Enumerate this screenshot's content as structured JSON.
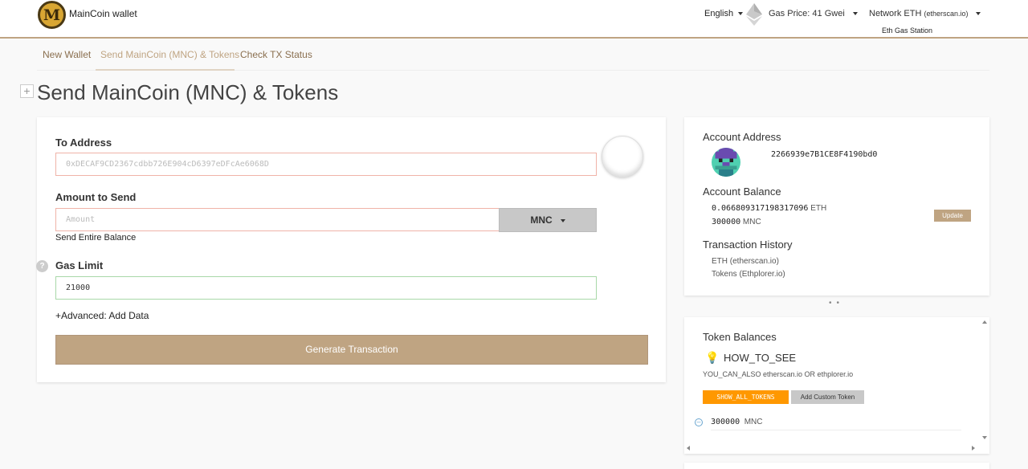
{
  "header": {
    "logo_letter": "M",
    "brand": "MainCoin wallet",
    "language": "English",
    "gas_price": "Gas Price: 41 Gwei",
    "network_label": "Network ETH",
    "network_source": "(etherscan.io)",
    "eth_gas_station": "Eth Gas Station"
  },
  "nav": {
    "tabs": [
      {
        "label": "New Wallet"
      },
      {
        "label": "Send MainCoin (MNC) & Tokens"
      },
      {
        "label": "Check TX Status"
      }
    ]
  },
  "page": {
    "plus": "+",
    "title": "Send MainCoin (MNC) & Tokens"
  },
  "form": {
    "to_address_label": "To Address",
    "to_address_placeholder": "0xDECAF9CD2367cdbb726E904cD6397eDFcAe6068D",
    "amount_label": "Amount to Send",
    "amount_placeholder": "Amount",
    "currency": "MNC",
    "send_entire_balance": "Send Entire Balance",
    "help": "?",
    "gas_limit_label": "Gas Limit",
    "gas_limit_value": "21000",
    "advanced": "+Advanced: Add Data",
    "generate_button": "Generate Transaction"
  },
  "account": {
    "address_title": "Account Address",
    "address": "2266939e7B1CE8F4190bd0",
    "balance_title": "Account Balance",
    "eth_amount": "0.066809317198317096",
    "eth_unit": "ETH",
    "mnc_amount": "300000",
    "mnc_unit": "MNC",
    "update_button": "Update",
    "history_title": "Transaction History",
    "history_eth": "ETH (etherscan.io)",
    "history_tokens": "Tokens (Ethplorer.io)"
  },
  "tokens": {
    "title": "Token Balances",
    "how_to_see": "HOW_TO_SEE",
    "you_can_also": "YOU_CAN_ALSO etherscan.io OR ethplorer.io",
    "show_all": "SHOW_ALL_TOKENS",
    "add_custom": "Add Custom Token",
    "rows": [
      {
        "amount": "300000",
        "symbol": "MNC"
      }
    ]
  },
  "colors": {
    "accent": "#bfa482",
    "orange": "#ff9800"
  }
}
